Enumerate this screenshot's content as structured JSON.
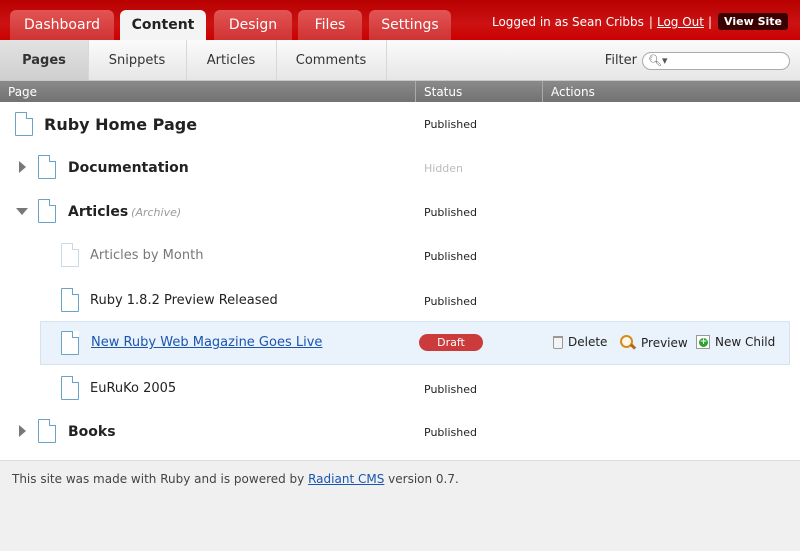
{
  "nav": {
    "tabs": [
      {
        "label": "Dashboard"
      },
      {
        "label": "Content"
      },
      {
        "label": "Design"
      },
      {
        "label": "Files"
      },
      {
        "label": "Settings"
      }
    ],
    "active_tab": "Content"
  },
  "user": {
    "logged_in_text": "Logged in as Sean Cribbs",
    "separator": "|",
    "logout": "Log Out",
    "view_site": "View Site"
  },
  "subnav": {
    "tabs": [
      {
        "label": "Pages"
      },
      {
        "label": "Snippets"
      },
      {
        "label": "Articles"
      },
      {
        "label": "Comments"
      }
    ],
    "active_tab": "Pages",
    "filter_label": "Filter",
    "filter_value": ""
  },
  "columns": {
    "page": "Page",
    "status": "Status",
    "actions": "Actions"
  },
  "rows": [
    {
      "name": "Ruby Home Page",
      "note": "",
      "status": "Published",
      "expander": "none",
      "style": "root"
    },
    {
      "name": "Documentation",
      "note": "",
      "status": "Hidden",
      "expander": "collapsed",
      "style": "bold"
    },
    {
      "name": "Articles",
      "note": "(Archive)",
      "status": "Published",
      "expander": "expanded",
      "style": "bold"
    },
    {
      "name": "Articles by Month",
      "note": "",
      "status": "Published",
      "expander": "none",
      "style": "muted"
    },
    {
      "name": "Ruby 1.8.2 Preview Released",
      "note": "",
      "status": "Published",
      "expander": "none",
      "style": "normal"
    },
    {
      "name": "New Ruby Web Magazine Goes Live",
      "note": "",
      "status": "Draft",
      "expander": "none",
      "style": "link",
      "highlighted": true
    },
    {
      "name": "EuRuKo 2005",
      "note": "",
      "status": "Published",
      "expander": "none",
      "style": "normal"
    },
    {
      "name": "Books",
      "note": "",
      "status": "Published",
      "expander": "collapsed",
      "style": "bold"
    }
  ],
  "row_actions": {
    "delete": "Delete",
    "preview": "Preview",
    "new_child": "New Child"
  },
  "footer": {
    "prefix": "This site was made with Ruby and is powered by",
    "link": "Radiant CMS",
    "suffix": "version 0.7."
  },
  "colors": {
    "header_red": "#cc1212",
    "draft_badge": "#cc3b3b",
    "link_blue": "#1a55b0",
    "highlight_row": "#eaf2fb"
  }
}
